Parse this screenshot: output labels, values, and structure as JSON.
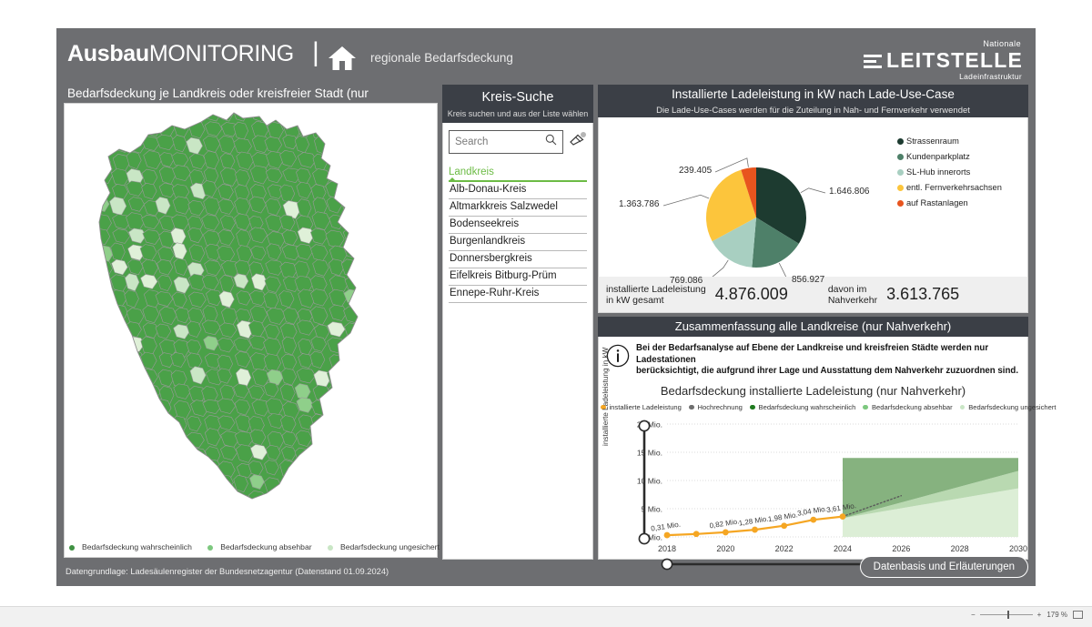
{
  "header": {
    "brand_bold": "Ausbau",
    "brand_light": "MONITORING",
    "divider": "|",
    "home_icon": "home-icon",
    "subtitle": "regionale Bedarfsdeckung",
    "logo_line1": "Nationale",
    "logo_line2": "LEITSTELLE",
    "logo_line3": "Ladeinfrastruktur"
  },
  "map_panel": {
    "title": "Bedarfsdeckung je Landkreis oder kreisfreier Stadt (nur Nahverkehr)",
    "legend": [
      {
        "label": "Bedarfsdeckung wahrscheinlich",
        "color": "#3f9142"
      },
      {
        "label": "Bedarfsdeckung absehbar",
        "color": "#7dc87f"
      },
      {
        "label": "Bedarfsdeckung ungesichert",
        "color": "#c9e6c5"
      }
    ]
  },
  "search_panel": {
    "title": "Kreis-Suche",
    "subtitle": "Kreis suchen und aus der Liste wählen",
    "search_placeholder": "Search",
    "search_value": "",
    "search_icon": "search-icon",
    "clear_icon": "eraser-icon",
    "column_header": "Landkreis",
    "items": [
      "Alb-Donau-Kreis",
      "Altmarkkreis Salzwedel",
      "Bodenseekreis",
      "Burgenlandkreis",
      "Donnersbergkreis",
      "Eifelkreis Bitburg-Prüm",
      "Ennepe-Ruhr-Kreis"
    ]
  },
  "pie_panel": {
    "title": "Installierte Ladeleistung in kW nach Lade-Use-Case",
    "subtitle": "Die Lade-Use-Cases werden für die Zuteilung in Nah- und Fernverkehr verwendet",
    "kpi": [
      {
        "label_line1": "installierte Ladeleistung",
        "label_line2": "in kW gesamt",
        "value": "4.876.009"
      },
      {
        "label_line1": "davon im",
        "label_line2": "Nahverkehr",
        "value": "3.613.765"
      }
    ]
  },
  "summary_panel": {
    "title": "Zusammenfassung alle Landkreise (nur Nahverkehr)",
    "info_icon": "info-icon",
    "info_text_line1": "Bei der Bedarfsanalyse auf Ebene der Landkreise und kreisfreien Städte werden nur Ladestationen",
    "info_text_line2": "berücksichtigt, die aufgrund ihrer Lage und Ausstattung dem Nahverkehr zuzuordnen sind.",
    "chart_title": "Bedarfsdeckung installierte Ladeleistung (nur Nahverkehr)"
  },
  "footer": {
    "note": "Datengrundlage: Ladesäulenregister der Bundesnetzagentur (Datenstand 01.09.2024)",
    "button": "Datenbasis und Erläuterungen"
  },
  "os_strip": {
    "zoom_value": "179 %",
    "zoom_out_icon": "minus-icon",
    "zoom_in_icon": "plus-icon",
    "fit_icon": "fit-screen-icon"
  },
  "chart_data": [
    {
      "type": "pie",
      "title": "Installierte Ladeleistung in kW nach Lade-Use-Case",
      "subtitle": "Die Lade-Use-Cases werden für die Zuteilung in Nah- und Fernverkehr verwendet",
      "legend_position": "right",
      "labels": [
        "Strassenraum",
        "Kundenparkplatz",
        "SL-Hub innerorts",
        "entl. Fernverkehrsachsen",
        "auf Rastanlagen"
      ],
      "values": [
        1646806,
        856927,
        769086,
        1363786,
        239405
      ],
      "value_labels": [
        "1.646.806",
        "856.927",
        "769.086",
        "1.363.786",
        "239.405"
      ],
      "colors": [
        "#1d3b30",
        "#4e8069",
        "#a8cfc1",
        "#fbc githubnull",
        "#e8541e"
      ],
      "slice_colors": [
        "#1d3b30",
        "#4e8069",
        "#a8cfc1",
        "#fcc53c",
        "#e8541e"
      ],
      "total": 4876009
    },
    {
      "type": "area",
      "title": "Bedarfsdeckung installierte Ladeleistung (nur Nahverkehr)",
      "xlabel": "",
      "ylabel": "installierte Ladeleistung in kW",
      "xlim": [
        2018,
        2030
      ],
      "ylim": [
        0,
        20000000
      ],
      "ytick_labels": [
        "0 Mio.",
        "5 Mio.",
        "10 Mio.",
        "15 Mio.",
        "20 Mio."
      ],
      "ytick_values": [
        0,
        5000000,
        10000000,
        15000000,
        20000000
      ],
      "xtick_labels": [
        "2018",
        "2020",
        "2022",
        "2024",
        "2026",
        "2028",
        "2030"
      ],
      "xtick_values": [
        2018,
        2020,
        2022,
        2024,
        2026,
        2028,
        2030
      ],
      "grid": true,
      "legend_position": "top",
      "legend": [
        {
          "name": "installierte Ladeleistung",
          "color": "#f5a623"
        },
        {
          "name": "Hochrechnung",
          "color": "#6f6f6f"
        },
        {
          "name": "Bedarfsdeckung wahrscheinlich",
          "color": "#1f7a1f"
        },
        {
          "name": "Bedarfsdeckung absehbar",
          "color": "#7dc87f"
        },
        {
          "name": "Bedarfsdeckung ungesichert",
          "color": "#c9e6c5"
        }
      ],
      "series": [
        {
          "name": "installierte Ladeleistung",
          "color": "#f5a623",
          "x": [
            2018,
            2019,
            2020,
            2021,
            2022,
            2023,
            2024
          ],
          "values": [
            310000,
            520000,
            820000,
            1280000,
            1980000,
            3040000,
            3610000
          ],
          "point_labels": [
            "0,31 Mio.",
            "",
            "0,82 Mio.",
            "1,28 Mio.",
            "1,98 Mio.",
            "3,04 Mio.",
            "3,61 Mio."
          ]
        },
        {
          "name": "Hochrechnung",
          "color": "#6f6f6f",
          "style": "dotted",
          "x": [
            2024,
            2026
          ],
          "values": [
            3610000,
            7300000
          ]
        },
        {
          "name": "Bedarfsdeckung wahrscheinlich",
          "color": "#86b27f",
          "x": [
            2024,
            2030
          ],
          "values": [
            14000000,
            14000000
          ],
          "fill_from": [
            3300000,
            11700000
          ]
        },
        {
          "name": "Bedarfsdeckung absehbar",
          "color": "#b5d5ad",
          "x": [
            2024,
            2030
          ],
          "values": [
            3300000,
            11700000
          ],
          "fill_from": [
            3300000,
            8600000
          ]
        },
        {
          "name": "Bedarfsdeckung ungesichert",
          "color": "#dceed6",
          "x": [
            2024,
            2030
          ],
          "values": [
            3300000,
            8600000
          ],
          "fill_from": [
            0,
            0
          ]
        }
      ]
    }
  ]
}
